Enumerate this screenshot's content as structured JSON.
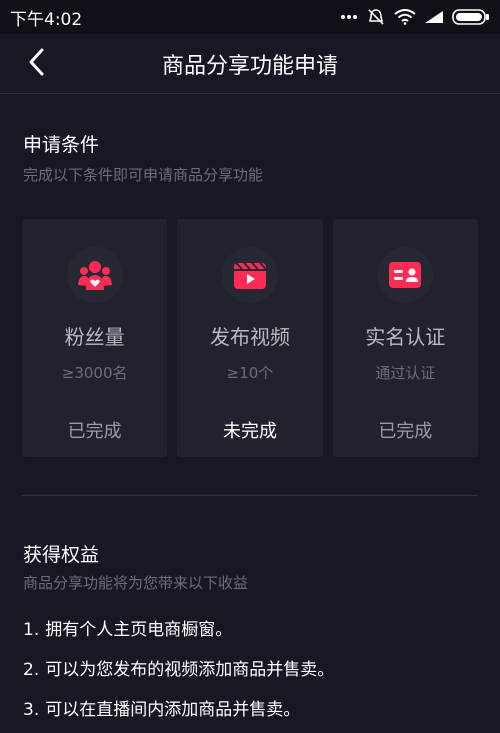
{
  "status_bar": {
    "time": "下午4:02",
    "icons": [
      "more-dots-icon",
      "mute-icon",
      "wifi-icon",
      "signal-icon",
      "battery-icon"
    ]
  },
  "nav": {
    "back_icon": "chevron-left-icon",
    "title": "商品分享功能申请"
  },
  "conditions": {
    "title": "申请条件",
    "subtitle": "完成以下条件即可申请商品分享功能",
    "cards": [
      {
        "icon": "fans-icon",
        "name": "粉丝量",
        "requirement": "≥3000名",
        "status": "已完成"
      },
      {
        "icon": "video-icon",
        "name": "发布视频",
        "requirement": "≥10个",
        "status": "未完成"
      },
      {
        "icon": "id-card-icon",
        "name": "实名认证",
        "requirement": "通过认证",
        "status": "已完成"
      }
    ]
  },
  "benefits": {
    "title": "获得权益",
    "subtitle": "商品分享功能将为您带来以下收益",
    "items": [
      {
        "num": "1.",
        "text": "拥有个人主页电商橱窗。"
      },
      {
        "num": "2.",
        "text": "可以为您发布的视频添加商品并售卖。"
      },
      {
        "num": "3.",
        "text": "可以在直播间内添加商品并售卖。"
      }
    ]
  },
  "colors": {
    "background": "#161823",
    "card": "#20222d",
    "accent": "#fe2c55"
  }
}
